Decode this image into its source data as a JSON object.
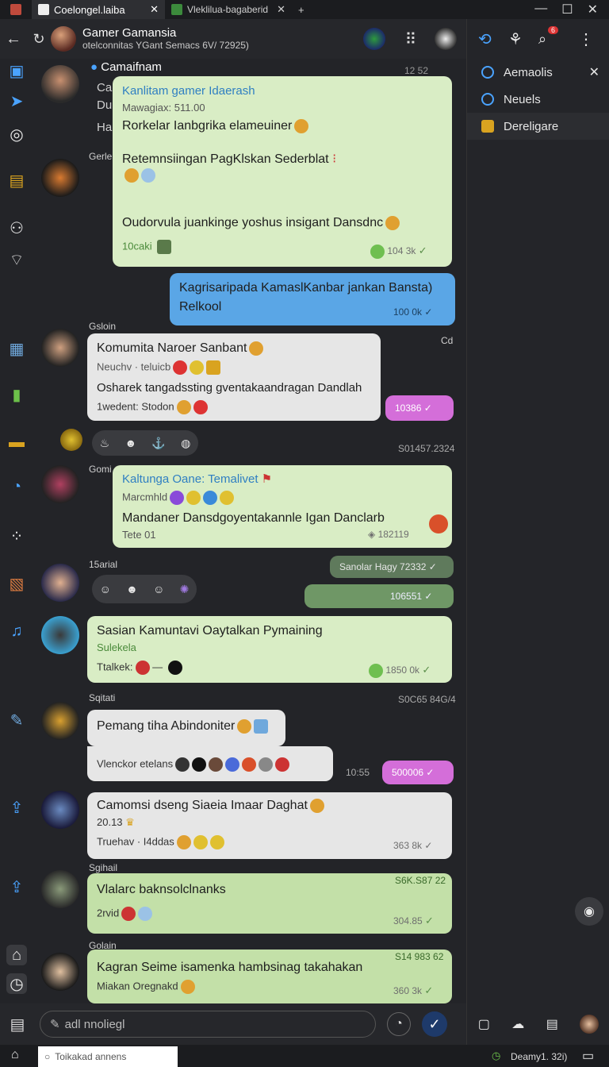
{
  "tabs": [
    {
      "label": "Coelongel.laiba",
      "active": true
    },
    {
      "label": "Vleklilua-bagaberid",
      "active": false
    }
  ],
  "window": {
    "minimize": "—",
    "maximize": "☐",
    "close": "✕",
    "new_tab": "+"
  },
  "header": {
    "title": "Gamer Gamansia",
    "subtitle": "otelconnitas YGant Semacs 6V/ 72925)",
    "notif_badge": "6"
  },
  "right_panel": {
    "items": [
      "Aemaolis",
      "Neuels",
      "Dereligare"
    ]
  },
  "chat": {
    "top_sender": "Camaifnam",
    "top_time": "12 52",
    "left_snippets": [
      "Ca",
      "Du",
      "Ha"
    ],
    "sender_gerle": "Gerle",
    "msg1": {
      "title": "Kanlitam gamer Idaerash",
      "sub": "Mawagiax: 511.00",
      "l1": "Rorkelar Ianbgrika elameuiner",
      "l2": "Retemnsiingan PagKlskan Sederblat",
      "l3": "Oudorvula juankinge yoshus insigant Dansdnc",
      "tag": "10caki",
      "time": "104 3k"
    },
    "msg2": {
      "l1": "Kagrisaripada KamaslKanbar jankan Bansta)",
      "l2": "Relkool",
      "time": "100 0k"
    },
    "sender_gsloin": "Gsloin",
    "cd": "Cd",
    "msg3": {
      "title": "Komumita Naroer Sanbant",
      "sub": "Neuchv · teluicb",
      "l1": "Osharek tangadssting gventakaandragan Dandlah",
      "l2": "1wedent: Stodon"
    },
    "pill1": "10386",
    "date1": "S01457.2324",
    "sender_gomi": "Gomi",
    "msg4": {
      "title": "Kaltunga Oane: Temalivet",
      "sub": "Marcmhld",
      "l1": "Mandaner Dansdgoyentakannle Igan Danclarb",
      "tag": "Tete 01",
      "time": "182119"
    },
    "sender_15": "15arial",
    "pill2": "Sanolar Hagy 72332",
    "pill3": "106551",
    "msg5": {
      "title": "Sasian Kamuntavi Oaytalkan Pymaining",
      "sub": "Sulekela",
      "l1": "Ttalkek:",
      "time": "1850 0k"
    },
    "sender_sqitati": "Sqitati",
    "date2": "S0C65 84G/4",
    "msg6": {
      "title": "Pemang tiha Abindoniter",
      "l1": "Vlenckor etelans",
      "time": "10:55"
    },
    "pill4": "500006",
    "msg7": {
      "title": "Camomsi dseng Siaeia Imaar Daghat",
      "sub": "20.13",
      "l1": "Truehav · I4ddas",
      "time": "363 8k"
    },
    "sender_sgihail": "Sgihail",
    "msg8": {
      "title": "Vlalarc baknsolclnanks",
      "l1": "2rvid",
      "stamp": "S6K.S87 22",
      "time": "304.85"
    },
    "sender_golain": "Golain",
    "msg9": {
      "title": "Kagran Seime isamenka hambsinag takahakan",
      "l1": "Miakan Oregnakd",
      "stamp": "S14 983 62",
      "time": "360 3k"
    }
  },
  "composer": {
    "placeholder": "adl nnoliegl"
  },
  "statusbar": {
    "search": "Toikakad annens",
    "right": "Deamy1. 32i)"
  },
  "colors": {
    "accent": "#4aa3ff",
    "bubble_green": "#d9edc5",
    "bubble_blue": "#5aa6e6",
    "bubble_pink": "#d46ed9"
  }
}
